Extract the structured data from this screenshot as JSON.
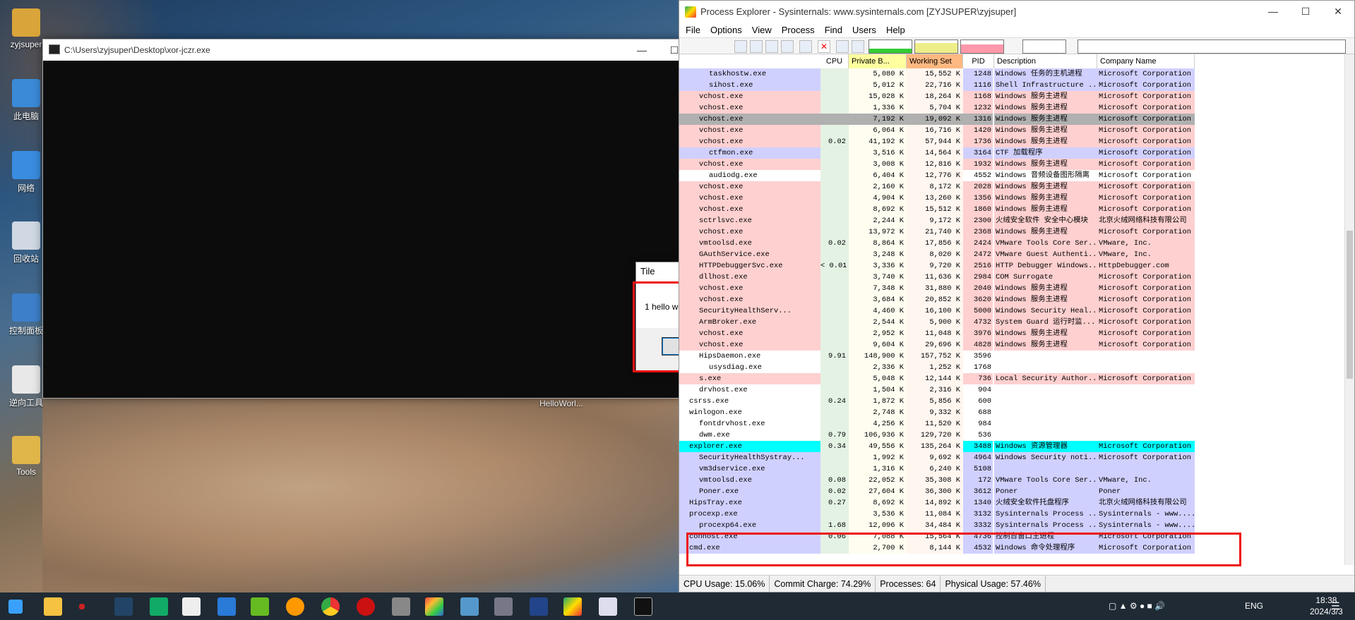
{
  "desktop": {
    "icons": [
      {
        "label": "zyjsuper",
        "color": "#d9a53a"
      },
      {
        "label": "此电脑",
        "color": "#3b8ad8"
      },
      {
        "label": "网络",
        "color": "#3a8ce0"
      },
      {
        "label": "回收站",
        "color": "#cfd8e3"
      },
      {
        "label": "控制面板",
        "color": "#3d7fc9"
      },
      {
        "label": "逆向工具",
        "color": "#e8e8e8"
      },
      {
        "label": "Tools",
        "color": "#e0b54a"
      }
    ],
    "floating_label": "HelloWorl..."
  },
  "console": {
    "title": "C:\\Users\\zyjsuper\\Desktop\\xor-jczr.exe"
  },
  "msgbox": {
    "title": "Tile",
    "message": "1 hello world",
    "ok_label": "确定"
  },
  "procexp": {
    "title": "Process Explorer - Sysinternals: www.sysinternals.com [ZYJSUPER\\zyjsuper]",
    "menu": [
      "File",
      "Options",
      "View",
      "Process",
      "Find",
      "Users",
      "Help"
    ],
    "columns": [
      "CPU",
      "Private B...",
      "Working Set",
      "PID",
      "Description",
      "Company Name"
    ],
    "colors": {
      "svc": "#ffd0d0",
      "user": "#d0d0ff",
      "own": "#00ffff",
      "selected": "#b0b0b0"
    },
    "rows": [
      {
        "name": "taskhostw.exe",
        "indent": 2,
        "cpu": "",
        "pb": "5,080 K",
        "ws": "15,552 K",
        "pid": "1248",
        "desc": "Windows 任务的主机进程",
        "comp": "Microsoft Corporation",
        "color": "user"
      },
      {
        "name": "sihost.exe",
        "indent": 2,
        "cpu": "",
        "pb": "5,012 K",
        "ws": "22,716 K",
        "pid": "1116",
        "desc": "Shell Infrastructure ...",
        "comp": "Microsoft Corporation",
        "color": "user"
      },
      {
        "name": "vchost.exe",
        "indent": 1,
        "cpu": "",
        "pb": "15,028 K",
        "ws": "18,264 K",
        "pid": "1168",
        "desc": "Windows 服务主进程",
        "comp": "Microsoft Corporation",
        "color": "svc"
      },
      {
        "name": "vchost.exe",
        "indent": 1,
        "cpu": "",
        "pb": "1,336 K",
        "ws": "5,704 K",
        "pid": "1232",
        "desc": "Windows 服务主进程",
        "comp": "Microsoft Corporation",
        "color": "svc"
      },
      {
        "name": "vchost.exe",
        "indent": 1,
        "cpu": "",
        "pb": "7,192 K",
        "ws": "19,092 K",
        "pid": "1316",
        "desc": "Windows 服务主进程",
        "comp": "Microsoft Corporation",
        "color": "selected"
      },
      {
        "name": "vchost.exe",
        "indent": 1,
        "cpu": "",
        "pb": "6,064 K",
        "ws": "16,716 K",
        "pid": "1420",
        "desc": "Windows 服务主进程",
        "comp": "Microsoft Corporation",
        "color": "svc"
      },
      {
        "name": "vchost.exe",
        "indent": 1,
        "cpu": "0.02",
        "pb": "41,192 K",
        "ws": "57,944 K",
        "pid": "1736",
        "desc": "Windows 服务主进程",
        "comp": "Microsoft Corporation",
        "color": "svc"
      },
      {
        "name": "ctfmon.exe",
        "indent": 2,
        "cpu": "",
        "pb": "3,516 K",
        "ws": "14,564 K",
        "pid": "3164",
        "desc": "CTF 加载程序",
        "comp": "Microsoft Corporation",
        "color": "user"
      },
      {
        "name": "vchost.exe",
        "indent": 1,
        "cpu": "",
        "pb": "3,008 K",
        "ws": "12,816 K",
        "pid": "1932",
        "desc": "Windows 服务主进程",
        "comp": "Microsoft Corporation",
        "color": "svc"
      },
      {
        "name": "audiodg.exe",
        "indent": 2,
        "cpu": "",
        "pb": "6,404 K",
        "ws": "12,776 K",
        "pid": "4552",
        "desc": "Windows 音频设备图形隔离",
        "comp": "Microsoft Corporation",
        "color": ""
      },
      {
        "name": "vchost.exe",
        "indent": 1,
        "cpu": "",
        "pb": "2,160 K",
        "ws": "8,172 K",
        "pid": "2028",
        "desc": "Windows 服务主进程",
        "comp": "Microsoft Corporation",
        "color": "svc"
      },
      {
        "name": "vchost.exe",
        "indent": 1,
        "cpu": "",
        "pb": "4,904 K",
        "ws": "13,260 K",
        "pid": "1356",
        "desc": "Windows 服务主进程",
        "comp": "Microsoft Corporation",
        "color": "svc"
      },
      {
        "name": "vchost.exe",
        "indent": 1,
        "cpu": "",
        "pb": "8,692 K",
        "ws": "15,512 K",
        "pid": "1860",
        "desc": "Windows 服务主进程",
        "comp": "Microsoft Corporation",
        "color": "svc"
      },
      {
        "name": "sctrlsvc.exe",
        "indent": 1,
        "cpu": "",
        "pb": "2,244 K",
        "ws": "9,172 K",
        "pid": "2300",
        "desc": "火绒安全软件 安全中心模块",
        "comp": "北京火绒网络科技有限公司",
        "color": "svc"
      },
      {
        "name": "vchost.exe",
        "indent": 1,
        "cpu": "",
        "pb": "13,972 K",
        "ws": "21,740 K",
        "pid": "2368",
        "desc": "Windows 服务主进程",
        "comp": "Microsoft Corporation",
        "color": "svc"
      },
      {
        "name": "vmtoolsd.exe",
        "indent": 1,
        "cpu": "0.02",
        "pb": "8,864 K",
        "ws": "17,856 K",
        "pid": "2424",
        "desc": "VMware Tools Core Ser...",
        "comp": "VMware, Inc.",
        "color": "svc"
      },
      {
        "name": "GAuthService.exe",
        "indent": 1,
        "cpu": "",
        "pb": "3,248 K",
        "ws": "8,020 K",
        "pid": "2472",
        "desc": "VMware Guest Authenti...",
        "comp": "VMware, Inc.",
        "color": "svc"
      },
      {
        "name": "HTTPDebuggerSvc.exe",
        "indent": 1,
        "cpu": "< 0.01",
        "pb": "3,336 K",
        "ws": "9,720 K",
        "pid": "2516",
        "desc": "HTTP Debugger Windows...",
        "comp": "HttpDebugger.com",
        "color": "svc"
      },
      {
        "name": "dllhost.exe",
        "indent": 1,
        "cpu": "",
        "pb": "3,740 K",
        "ws": "11,636 K",
        "pid": "2984",
        "desc": "COM Surrogate",
        "comp": "Microsoft Corporation",
        "color": "svc"
      },
      {
        "name": "vchost.exe",
        "indent": 1,
        "cpu": "",
        "pb": "7,348 K",
        "ws": "31,880 K",
        "pid": "2040",
        "desc": "Windows 服务主进程",
        "comp": "Microsoft Corporation",
        "color": "svc"
      },
      {
        "name": "vchost.exe",
        "indent": 1,
        "cpu": "",
        "pb": "3,684 K",
        "ws": "20,852 K",
        "pid": "3620",
        "desc": "Windows 服务主进程",
        "comp": "Microsoft Corporation",
        "color": "svc"
      },
      {
        "name": "SecurityHealthServ...",
        "indent": 1,
        "cpu": "",
        "pb": "4,460 K",
        "ws": "16,100 K",
        "pid": "5000",
        "desc": "Windows Security Heal...",
        "comp": "Microsoft Corporation",
        "color": "svc"
      },
      {
        "name": "ArmBroker.exe",
        "indent": 1,
        "cpu": "",
        "pb": "2,544 K",
        "ws": "5,900 K",
        "pid": "4732",
        "desc": "System Guard 运行时监...",
        "comp": "Microsoft Corporation",
        "color": "svc"
      },
      {
        "name": "vchost.exe",
        "indent": 1,
        "cpu": "",
        "pb": "2,952 K",
        "ws": "11,048 K",
        "pid": "3976",
        "desc": "Windows 服务主进程",
        "comp": "Microsoft Corporation",
        "color": "svc"
      },
      {
        "name": "vchost.exe",
        "indent": 1,
        "cpu": "",
        "pb": "9,604 K",
        "ws": "29,696 K",
        "pid": "4828",
        "desc": "Windows 服务主进程",
        "comp": "Microsoft Corporation",
        "color": "svc"
      },
      {
        "name": "HipsDaemon.exe",
        "indent": 1,
        "cpu": "9.91",
        "pb": "148,900 K",
        "ws": "157,752 K",
        "pid": "3596",
        "desc": "",
        "comp": "",
        "color": ""
      },
      {
        "name": "usysdiag.exe",
        "indent": 2,
        "cpu": "",
        "pb": "2,336 K",
        "ws": "1,252 K",
        "pid": "1768",
        "desc": "",
        "comp": "",
        "color": ""
      },
      {
        "name": "s.exe",
        "indent": 1,
        "cpu": "",
        "pb": "5,048 K",
        "ws": "12,144 K",
        "pid": "736",
        "desc": "Local Security Author...",
        "comp": "Microsoft Corporation",
        "color": "svc"
      },
      {
        "name": "drvhost.exe",
        "indent": 1,
        "cpu": "",
        "pb": "1,504 K",
        "ws": "2,316 K",
        "pid": "904",
        "desc": "",
        "comp": "",
        "color": ""
      },
      {
        "name": "csrss.exe",
        "indent": 0,
        "cpu": "0.24",
        "pb": "1,872 K",
        "ws": "5,856 K",
        "pid": "600",
        "desc": "",
        "comp": "",
        "color": ""
      },
      {
        "name": "winlogon.exe",
        "indent": 0,
        "cpu": "",
        "pb": "2,748 K",
        "ws": "9,332 K",
        "pid": "688",
        "desc": "",
        "comp": "",
        "color": ""
      },
      {
        "name": "fontdrvhost.exe",
        "indent": 1,
        "cpu": "",
        "pb": "4,256 K",
        "ws": "11,520 K",
        "pid": "984",
        "desc": "",
        "comp": "",
        "color": ""
      },
      {
        "name": "dwm.exe",
        "indent": 1,
        "cpu": "0.79",
        "pb": "106,936 K",
        "ws": "129,720 K",
        "pid": "536",
        "desc": "",
        "comp": "",
        "color": ""
      },
      {
        "name": "explorer.exe",
        "indent": 0,
        "cpu": "0.34",
        "pb": "49,556 K",
        "ws": "135,264 K",
        "pid": "3488",
        "desc": "Windows 资源管理器",
        "comp": "Microsoft Corporation",
        "color": "own"
      },
      {
        "name": "SecurityHealthSystray...",
        "indent": 1,
        "cpu": "",
        "pb": "1,992 K",
        "ws": "9,692 K",
        "pid": "4964",
        "desc": "Windows Security noti...",
        "comp": "Microsoft Corporation",
        "color": "user"
      },
      {
        "name": "vm3dservice.exe",
        "indent": 1,
        "cpu": "",
        "pb": "1,316 K",
        "ws": "6,240 K",
        "pid": "5108",
        "desc": "",
        "comp": "",
        "color": "user"
      },
      {
        "name": "vmtoolsd.exe",
        "indent": 1,
        "cpu": "0.08",
        "pb": "22,052 K",
        "ws": "35,308 K",
        "pid": "172",
        "desc": "VMware Tools Core Ser...",
        "comp": "VMware, Inc.",
        "color": "user"
      },
      {
        "name": "Poner.exe",
        "indent": 1,
        "cpu": "0.02",
        "pb": "27,604 K",
        "ws": "36,300 K",
        "pid": "3612",
        "desc": "Poner",
        "comp": "Poner",
        "color": "user"
      },
      {
        "name": "HipsTray.exe",
        "indent": 0,
        "cpu": "0.27",
        "pb": "8,692 K",
        "ws": "14,892 K",
        "pid": "1340",
        "desc": "火绒安全软件托盘程序",
        "comp": "北京火绒网络科技有限公司",
        "color": "user"
      },
      {
        "name": "procexp.exe",
        "indent": 0,
        "cpu": "",
        "pb": "3,536 K",
        "ws": "11,084 K",
        "pid": "3132",
        "desc": "Sysinternals Process ...",
        "comp": "Sysinternals - www....",
        "color": "user"
      },
      {
        "name": "procexp64.exe",
        "indent": 1,
        "cpu": "1.68",
        "pb": "12,096 K",
        "ws": "34,484 K",
        "pid": "3332",
        "desc": "Sysinternals Process ...",
        "comp": "Sysinternals - www....",
        "color": "user"
      },
      {
        "name": "conhost.exe",
        "indent": 0,
        "cpu": "0.06",
        "pb": "7,088 K",
        "ws": "15,564 K",
        "pid": "4736",
        "desc": "控制台窗口主进程",
        "comp": "Microsoft Corporation",
        "color": "user"
      },
      {
        "name": "cmd.exe",
        "indent": 0,
        "cpu": "",
        "pb": "2,700 K",
        "ws": "8,144 K",
        "pid": "4532",
        "desc": "Windows 命令处理程序",
        "comp": "Microsoft Corporation",
        "color": "user"
      }
    ],
    "status": {
      "cpu": "CPU Usage: 15.06%",
      "commit": "Commit Charge: 74.29%",
      "processes": "Processes: 64",
      "physical": "Physical Usage: 57.46%"
    }
  },
  "taskbar": {
    "lang": "ENG",
    "time": "18:38",
    "date": "2024/3/3"
  }
}
